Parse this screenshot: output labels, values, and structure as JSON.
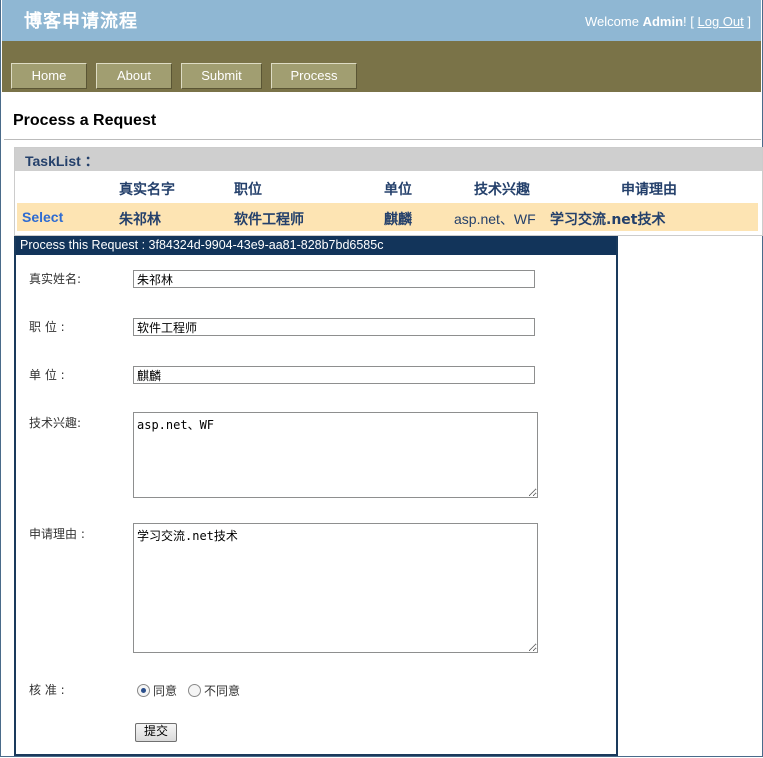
{
  "header": {
    "title": "博客申请流程",
    "welcome": "Welcome",
    "user": "Admin",
    "suffix": "! [",
    "logout": "Log Out",
    "close_bracket": "]"
  },
  "menu": [
    "Home",
    "About",
    "Submit",
    "Process"
  ],
  "page_title": "Process a Request",
  "tasklist": {
    "label": "TaskList ：",
    "columns": [
      "真实名字",
      "职位",
      "单位",
      "技术兴趣",
      "申请理由"
    ],
    "rows": [
      {
        "action": "Select",
        "name": "朱祁林",
        "position": "软件工程师",
        "unit": "麒麟",
        "interest": "asp.net、WF",
        "reason": "学习交流.net技术"
      }
    ]
  },
  "form": {
    "header": "Process this Request : 3f84324d-9904-43e9-aa81-828b7bd6585c",
    "name_label": "真实姓名:",
    "name_value": "朱祁林",
    "position_label": "职 位 :",
    "position_value": "软件工程师",
    "unit_label": "单 位 :",
    "unit_value": "麒麟",
    "interest_label": "技术兴趣:",
    "interest_value": "asp.net、WF",
    "reason_label": "申请理由 :",
    "reason_value": "学习交流.net技术",
    "approve_label": "核 准 :",
    "approve_yes": "同意",
    "approve_no": "不同意",
    "approve_selected": "同意",
    "submit_label": "提交"
  },
  "colors": {
    "header_bg": "#8fb7d3",
    "menubar_bg": "#7a7348",
    "menu_item_bg": "#a19e71",
    "table_header_text": "#24406b",
    "selected_row_bg": "#fde4b3",
    "panel_header_bg": "#12345a"
  }
}
